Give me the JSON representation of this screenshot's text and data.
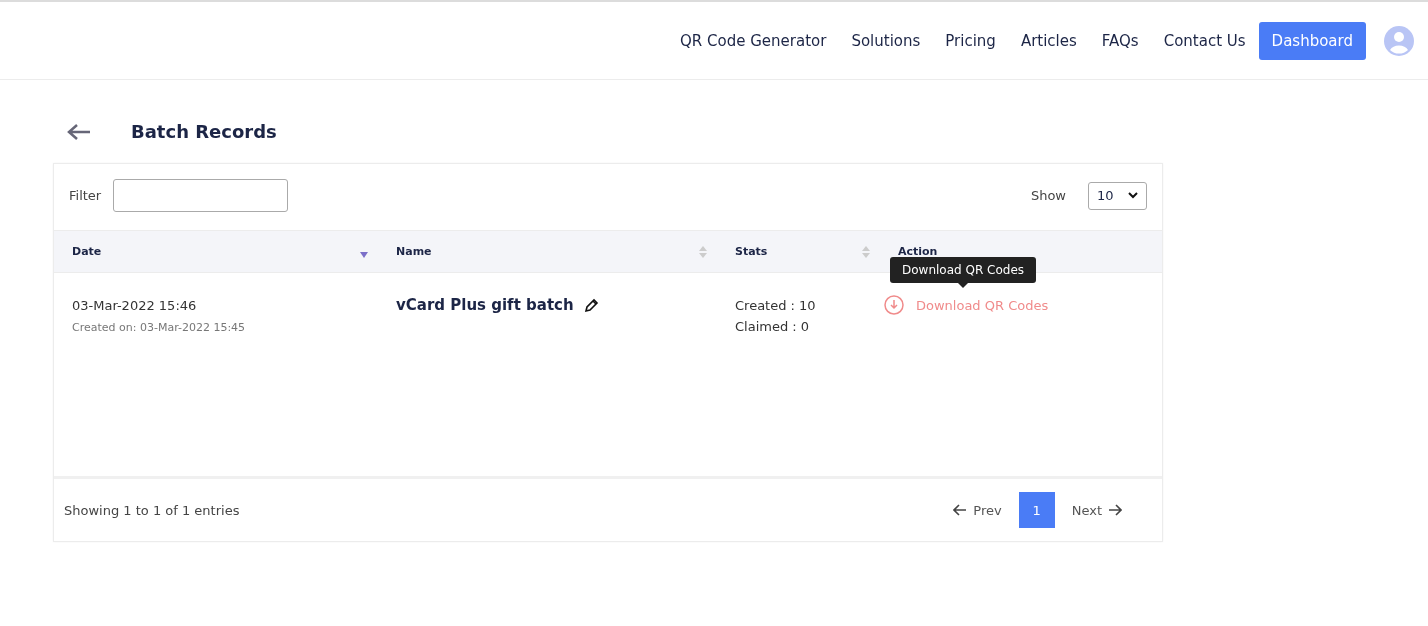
{
  "nav": {
    "links": [
      "QR Code Generator",
      "Solutions",
      "Pricing",
      "Articles",
      "FAQs",
      "Contact Us"
    ],
    "cta": "Dashboard"
  },
  "page": {
    "title": "Batch Records"
  },
  "filter": {
    "label": "Filter"
  },
  "show": {
    "label": "Show",
    "value": "10"
  },
  "table": {
    "columns": [
      {
        "label": "Date",
        "sorted": true
      },
      {
        "label": "Name",
        "sorted": false
      },
      {
        "label": "Stats",
        "sorted": false
      },
      {
        "label": "Action"
      }
    ],
    "rows": [
      {
        "date": "03-Mar-2022 15:46",
        "created_on": "Created on: 03-Mar-2022 15:45",
        "name": "vCard Plus gift batch",
        "stats": [
          "Created : 10",
          "Claimed : 0"
        ],
        "action": "Download QR Codes"
      }
    ]
  },
  "tooltip": "Download QR Codes",
  "footer": {
    "summary": "Showing 1 to 1 of 1 entries",
    "prev": "Prev",
    "pages": [
      {
        "label": "1",
        "selected": true
      }
    ],
    "next": "Next"
  }
}
